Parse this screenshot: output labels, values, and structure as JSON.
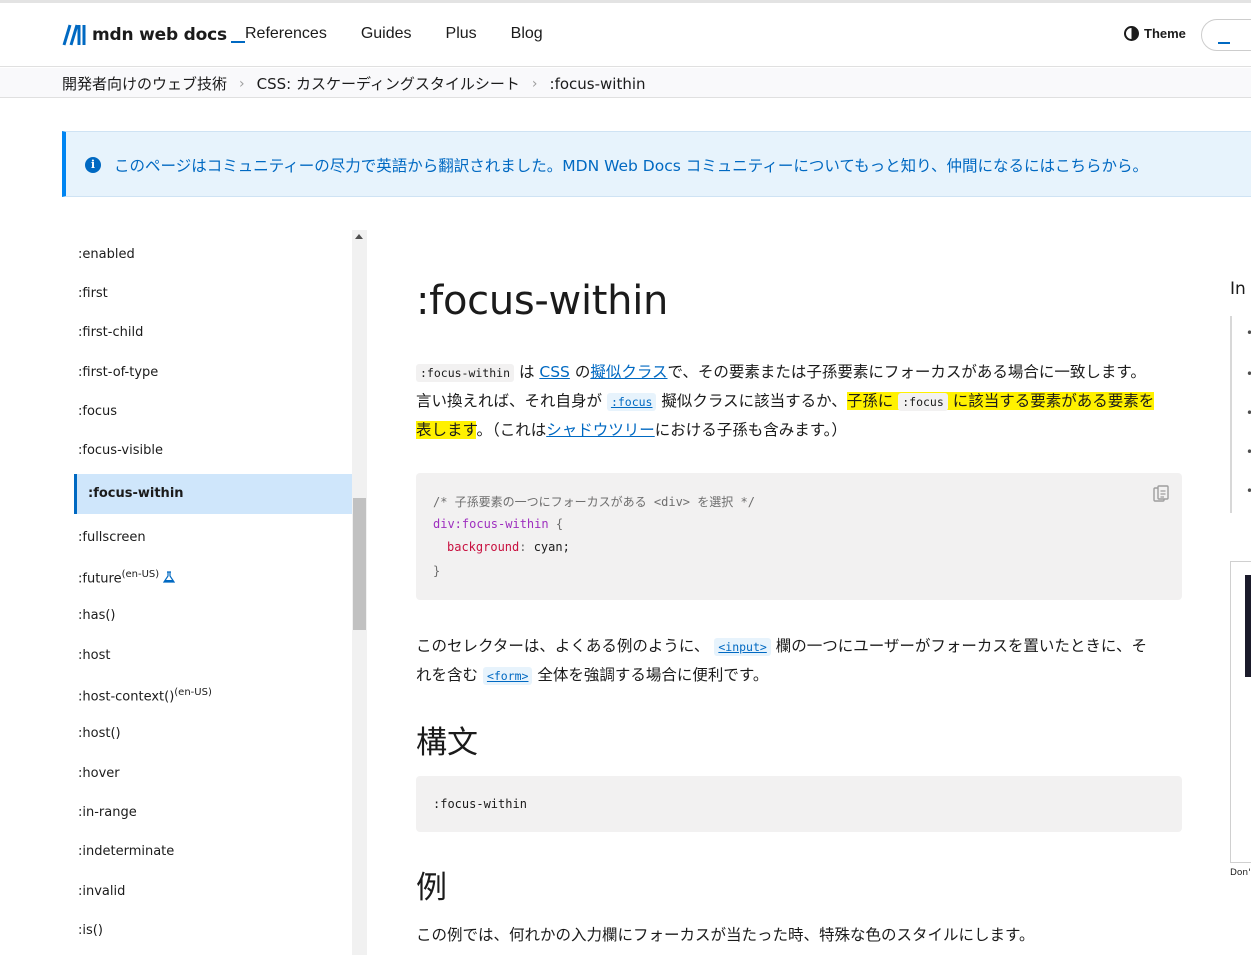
{
  "header": {
    "logo_text": "mdn web docs",
    "nav": [
      "References",
      "Guides",
      "Plus",
      "Blog"
    ],
    "theme_label": "Theme"
  },
  "breadcrumb": [
    "開発者向けのウェブ技術",
    "CSS: カスケーディングスタイルシート",
    ":focus-within"
  ],
  "banner": {
    "text": "このページはコミュニティーの尽力で英語から翻訳されました。MDN Web Docs コミュニティーについてもっと知り、仲間になるにはこちらから。"
  },
  "sidebar": {
    "items": [
      ":enabled",
      ":first",
      ":first-child",
      ":first-of-type",
      ":focus",
      ":focus-visible",
      ":focus-within",
      ":fullscreen",
      ":future",
      ":has()",
      ":host",
      ":host-context()",
      ":host()",
      ":hover",
      ":in-range",
      ":indeterminate",
      ":invalid",
      ":is()"
    ],
    "active": ":focus-within",
    "locale_tag": "(en-US)"
  },
  "main": {
    "title": ":focus-within",
    "intro": {
      "code1": ":focus-within",
      "t1": " は ",
      "link_css": "CSS",
      "t2": " の",
      "link_pseudo": "擬似クラス",
      "t3": "で、その要素または子孫要素にフォーカスがある場合に一致します。",
      "t4": "言い換えれば、それ自身が ",
      "code_focus": ":focus",
      "t5": " 擬似クラスに該当するか、",
      "hl1": "子孫に ",
      "code_focus2": ":focus",
      "hl2": " に該当する要素がある要素を",
      "hl3": "表します",
      "t6": "。（これは",
      "link_shadow": "シャドウツリー",
      "t7": "における子孫も含みます。）"
    },
    "code_example": {
      "comment": "/* 子孫要素の一つにフォーカスがある <div> を選択 */",
      "selector": "div:focus-within",
      "brace_open": " {",
      "property": "background",
      "colon": ": ",
      "value": "cyan;",
      "brace_close": "}"
    },
    "para2": {
      "t1": "このセレクターは、よくある例のように、 ",
      "code_input": "<input>",
      "t2": " 欄の一つにユーザーがフォーカスを置いたときに、そ",
      "t3": "れを含む ",
      "code_form": "<form>",
      "t4": " 全体を強調する場合に便利です。"
    },
    "syntax_heading": "構文",
    "syntax_code": ":focus-within",
    "example_heading": "例",
    "example_text": "この例では、何れかの入力欄にフォーカスが当たった時、特殊な色のスタイルにします。"
  },
  "toc": {
    "title_fragment": "In",
    "bottom_fragment": "Don'"
  },
  "colors": {
    "accent": "#0069c2",
    "highlight": "#fff100",
    "active_bg": "#cfe6fb"
  }
}
